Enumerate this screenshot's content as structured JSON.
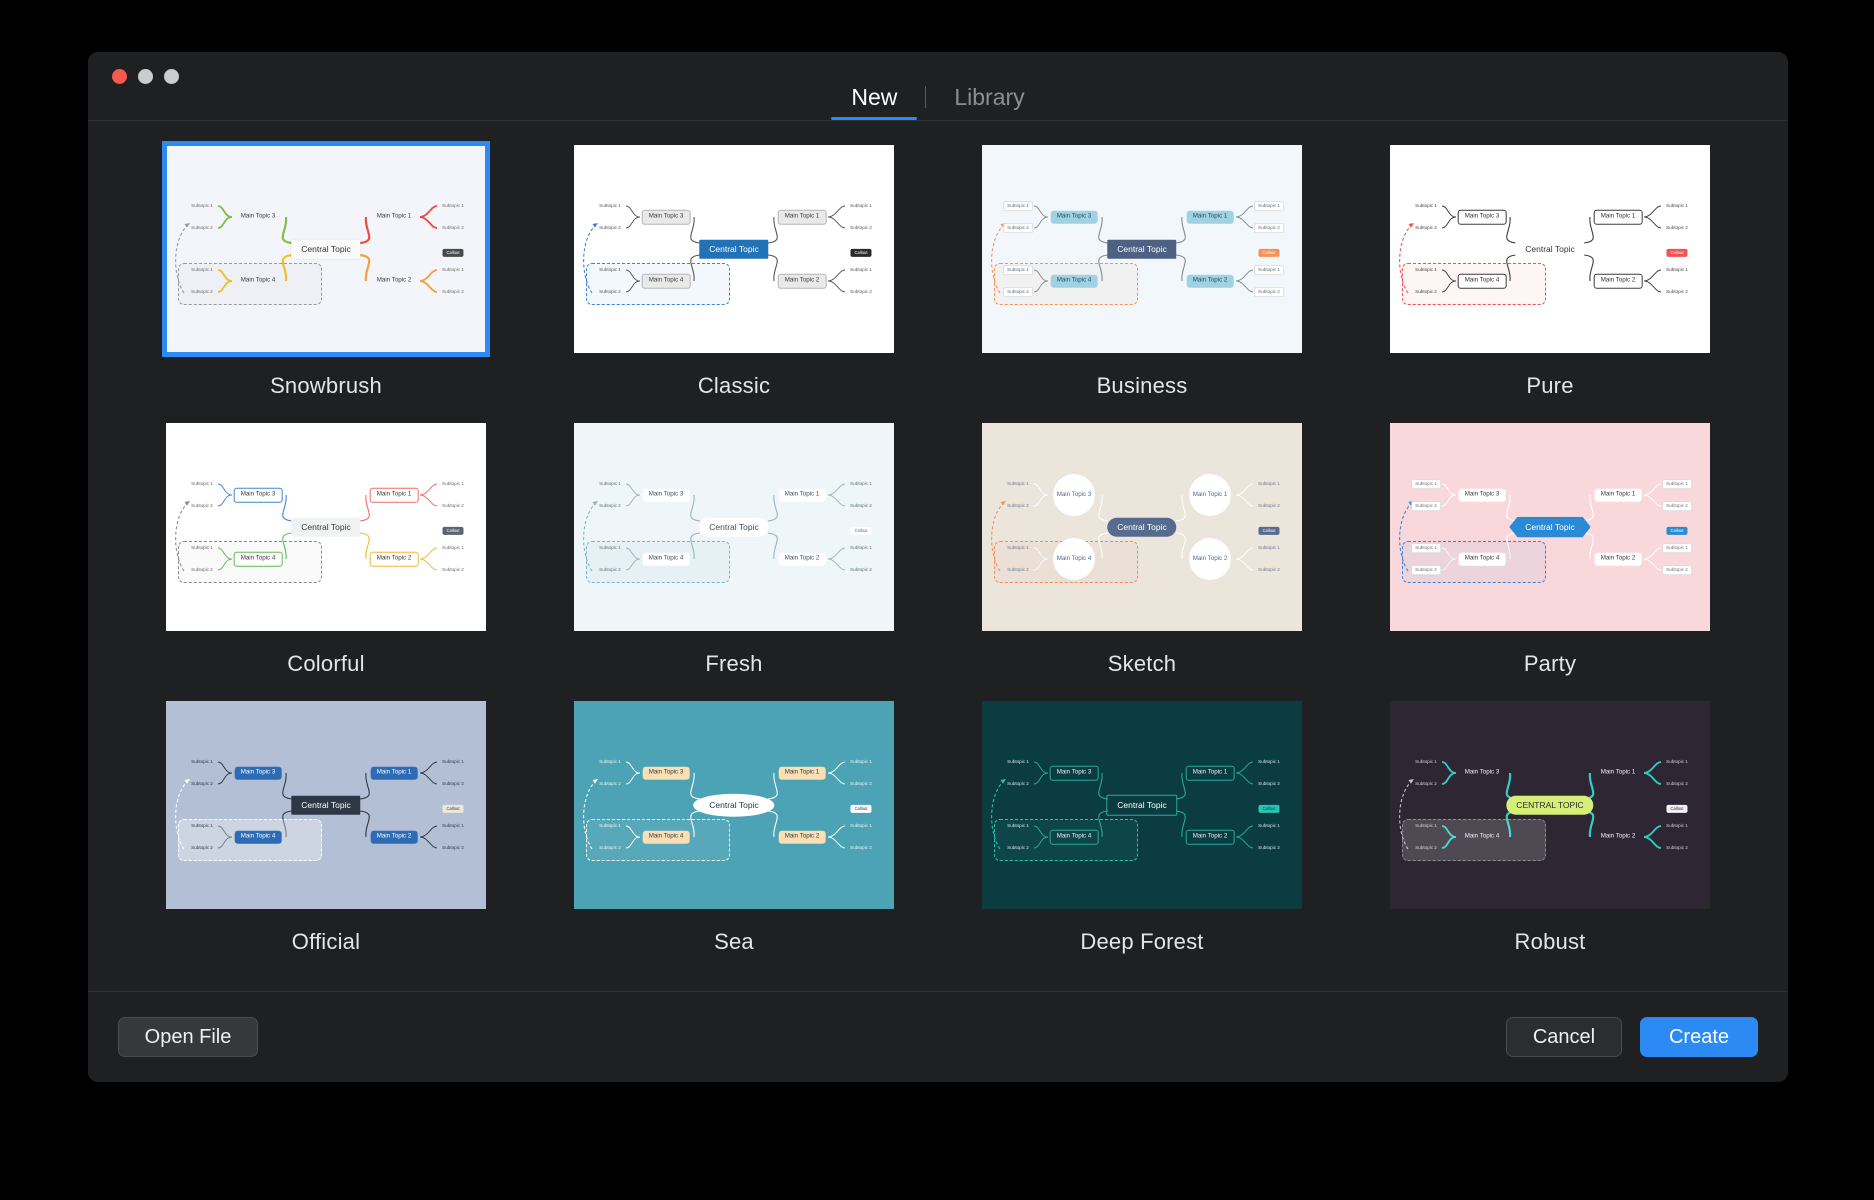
{
  "window": {
    "traffic_lights": [
      "close",
      "minimize",
      "maximize"
    ]
  },
  "tabs": [
    {
      "label": "New",
      "active": true
    },
    {
      "label": "Library",
      "active": false
    }
  ],
  "labels": {
    "central": "Central Topic",
    "central_upper": "CENTRAL TOPIC",
    "main1": "Main Topic 1",
    "main2": "Main Topic 2",
    "main3": "Main Topic 3",
    "main4": "Main Topic 4",
    "sub1": "Subtopic 1",
    "sub2": "Subtopic 2",
    "callout": "Callout"
  },
  "footer": {
    "open_file": "Open File",
    "cancel": "Cancel",
    "create": "Create"
  },
  "colors": {
    "accent": "#2b8af3",
    "window_bg": "#1f2021",
    "text": "#e4e5e6"
  },
  "templates": [
    {
      "name": "Snowbrush",
      "selected": true,
      "bg": "#f4f5fa",
      "central_bg": "#fafafa",
      "central_fg": "#333333",
      "central_shape": "rect",
      "main_bg": "transparent",
      "main_fg": "#3b3b3b",
      "main_border": "none",
      "sub_bg": "transparent",
      "sub_fg": "#6b6b6b",
      "line1": "#ef4b44",
      "line2": "#f0a23c",
      "line3": "#7dc242",
      "line4": "#f2c230",
      "callout_bg": "#4a4a4a",
      "callout_fg": "#ffffff",
      "boundary_border": "#9a9a9a",
      "boundary_bg": "rgba(0,0,0,0.02)",
      "rel_color": "#9a9a9a"
    },
    {
      "name": "Classic",
      "selected": false,
      "bg": "#ffffff",
      "central_bg": "#2272b8",
      "central_fg": "#ffffff",
      "central_shape": "rect",
      "main_bg": "#e9e9e9",
      "main_fg": "#3b3b3b",
      "main_border": "#b5b5b5",
      "sub_bg": "transparent",
      "sub_fg": "#555555",
      "line1": "#555555",
      "line2": "#555555",
      "line3": "#555555",
      "line4": "#555555",
      "callout_bg": "#2b2b2b",
      "callout_fg": "#ffffff",
      "boundary_border": "#3b82d6",
      "boundary_bg": "rgba(59,130,214,0.06)",
      "rel_color": "#3b82d6"
    },
    {
      "name": "Business",
      "selected": false,
      "bg": "#f2f7fb",
      "central_bg": "#4d6184",
      "central_fg": "#ffffff",
      "central_shape": "rect",
      "main_bg": "#9ed2e4",
      "main_fg": "#2f4a5c",
      "main_border": "none",
      "sub_bg": "#ffffff",
      "sub_fg": "#5c6b76",
      "line1": "#7f8c96",
      "line2": "#7f8c96",
      "line3": "#7f8c96",
      "line4": "#7f8c96",
      "callout_bg": "#f5915a",
      "callout_fg": "#ffffff",
      "boundary_border": "#f5915a",
      "boundary_bg": "rgba(245,145,90,0.06)",
      "rel_color": "#f5915a"
    },
    {
      "name": "Pure",
      "selected": false,
      "bg": "#ffffff",
      "central_bg": "#ffffff",
      "central_fg": "#333333",
      "central_shape": "rect",
      "main_bg": "#ffffff",
      "main_fg": "#333333",
      "main_border": "#3b3b3b",
      "sub_bg": "transparent",
      "sub_fg": "#444444",
      "line1": "#3b3b3b",
      "line2": "#3b3b3b",
      "line3": "#3b3b3b",
      "line4": "#3b3b3b",
      "callout_bg": "#f05252",
      "callout_fg": "#ffffff",
      "boundary_border": "#f05252",
      "boundary_bg": "rgba(240,82,82,0.06)",
      "rel_color": "#f05252"
    },
    {
      "name": "Colorful",
      "selected": false,
      "bg": "#ffffff",
      "central_bg": "#f1f2f4",
      "central_fg": "#3b3b3b",
      "central_shape": "rect",
      "main_bg": "#ffffff",
      "main_fg": "#3b3b3b",
      "main_border": "multi",
      "sub_bg": "transparent",
      "sub_fg": "#666666",
      "line1": "#ef6d64",
      "line2": "#f2b63c",
      "line3": "#3f86d6",
      "line4": "#63bb56",
      "callout_bg": "#5a6470",
      "callout_fg": "#ffffff",
      "boundary_border": "#8a8a8a",
      "boundary_bg": "rgba(0,0,0,0.02)",
      "rel_color": "#8a8a8a"
    },
    {
      "name": "Fresh",
      "selected": false,
      "bg": "#eef6f9",
      "central_bg": "#ffffff",
      "central_fg": "#3d4f63",
      "central_shape": "pill",
      "main_bg": "#ffffff",
      "main_fg": "#3d4f63",
      "main_border": "none",
      "sub_bg": "transparent",
      "sub_fg": "#55707f",
      "line1": "#9bb3bf",
      "line2": "#9bb3bf",
      "line3": "#9bb3bf",
      "line4": "#9bb3bf",
      "callout_bg": "#ffffff",
      "callout_fg": "#55707f",
      "boundary_border": "#7fb4cc",
      "boundary_bg": "rgba(127,180,204,0.07)",
      "rel_color": "#7fb4cc"
    },
    {
      "name": "Sketch",
      "selected": false,
      "bg": "#ebe5dc",
      "central_bg": "#566b8d",
      "central_fg": "#ffffff",
      "central_shape": "pill",
      "main_bg": "#ffffff",
      "main_fg": "#566b8d",
      "main_border": "circle",
      "sub_bg": "transparent",
      "sub_fg": "#6a7890",
      "line1": "#ffffff",
      "line2": "#ffffff",
      "line3": "#ffffff",
      "line4": "#ffffff",
      "callout_bg": "#566b8d",
      "callout_fg": "#ffffff",
      "boundary_border": "#ef8f5c",
      "boundary_bg": "rgba(239,143,92,0.05)",
      "rel_color": "#ef8f5c"
    },
    {
      "name": "Party",
      "selected": false,
      "bg": "#f9d8dc",
      "central_bg": "#2b8ad6",
      "central_fg": "#ffffff",
      "central_shape": "hex",
      "main_bg": "#ffffff",
      "main_fg": "#3b3b3b",
      "main_border": "none",
      "sub_bg": "#ffffff",
      "sub_fg": "#7a6b6e",
      "line1": "#ffffff",
      "line2": "#ffffff",
      "line3": "#ffffff",
      "line4": "#ffffff",
      "callout_bg": "#2b8ad6",
      "callout_fg": "#ffffff",
      "boundary_border": "#3b82d6",
      "boundary_bg": "rgba(59,130,214,0.06)",
      "rel_color": "#3b82d6"
    },
    {
      "name": "Official",
      "selected": false,
      "bg": "#b2bfd4",
      "central_bg": "#2e3744",
      "central_fg": "#ffffff",
      "central_shape": "rect",
      "main_bg": "#2d6cb5",
      "main_fg": "#ffffff",
      "main_border": "none",
      "sub_bg": "transparent",
      "sub_fg": "#2e3744",
      "line1": "#2e3744",
      "line2": "#2e3744",
      "line3": "#2e3744",
      "line4": "#2e3744",
      "callout_bg": "#ede8dc",
      "callout_fg": "#3b3b3b",
      "boundary_border": "#ffffff",
      "boundary_bg": "rgba(255,255,255,0.35)",
      "rel_color": "#ffffff"
    },
    {
      "name": "Sea",
      "selected": false,
      "bg": "#4ba3b5",
      "central_bg": "#ffffff",
      "central_fg": "#2b3a42",
      "central_shape": "ellipse",
      "main_bg": "#fbdfb4",
      "main_fg": "#2b3a42",
      "main_border": "none",
      "sub_bg": "transparent",
      "sub_fg": "#f2f7f8",
      "line1": "#ffffff",
      "line2": "#ffffff",
      "line3": "#ffffff",
      "line4": "#ffffff",
      "callout_bg": "#ffffff",
      "callout_fg": "#2b3a42",
      "boundary_border": "#ffffff",
      "boundary_bg": "rgba(255,255,255,0.07)",
      "rel_color": "#ffffff"
    },
    {
      "name": "Deep Forest",
      "selected": false,
      "bg": "#0b3c42",
      "central_bg": "transparent",
      "central_fg": "#ffffff",
      "central_shape": "rect",
      "main_bg": "transparent",
      "main_fg": "#e8f5f3",
      "main_border": "#2ea898",
      "sub_bg": "transparent",
      "sub_fg": "#d4eae7",
      "line1": "#2ea898",
      "line2": "#2ea898",
      "line3": "#2ea898",
      "line4": "#2ea898",
      "callout_bg": "#27c5b2",
      "callout_fg": "#0b3c42",
      "boundary_border": "#27c5b2",
      "boundary_bg": "rgba(39,197,178,0.07)",
      "rel_color": "#27c5b2"
    },
    {
      "name": "Robust",
      "selected": false,
      "bg": "#2e2733",
      "central_bg": "#d6ef76",
      "central_fg": "#2b2b2b",
      "central_shape": "pill",
      "main_bg": "transparent",
      "main_fg": "#f3f1f5",
      "main_border": "none",
      "sub_bg": "transparent",
      "sub_fg": "#d7d2dc",
      "line1": "#2ecfc0",
      "line2": "#2ecfc0",
      "line3": "#2ecfc0",
      "line4": "#2ecfc0",
      "callout_bg": "#f3f1f5",
      "callout_fg": "#2b2b2b",
      "boundary_border": "#8e8796",
      "boundary_bg": "rgba(255,255,255,0.16)",
      "rel_color": "#c9c4d0"
    }
  ]
}
